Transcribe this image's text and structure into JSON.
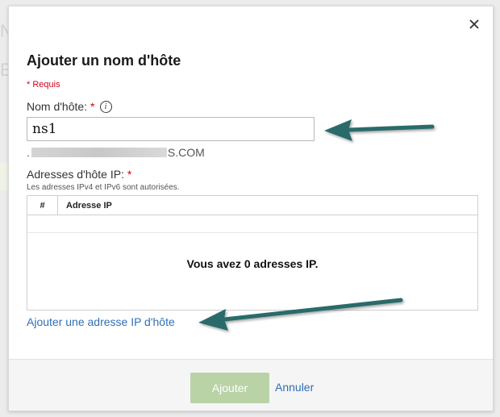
{
  "dialog": {
    "title": "Ajouter un nom d'hôte",
    "required_note": "* Requis",
    "close_icon": "close-icon"
  },
  "hostname": {
    "label": "Nom d'hôte:",
    "required_marker": "*",
    "info_icon": "info-icon",
    "value": "ns1",
    "domain_prefix": ".",
    "domain_suffix": "S.COM"
  },
  "ip_addresses": {
    "label": "Adresses d'hôte IP:",
    "required_marker": "*",
    "hint": "Les adresses IPv4 et IPv6 sont autorisées.",
    "columns": [
      "#",
      "Adresse IP"
    ],
    "empty_message": "Vous avez 0 adresses IP.",
    "add_link": "Ajouter une adresse IP d'hôte"
  },
  "footer": {
    "submit_label": "Ajouter",
    "cancel_label": "Annuler"
  },
  "colors": {
    "required": "#d0021b",
    "link": "#2f6fb3",
    "submit_disabled": "#b9d3a6",
    "annotation_arrow": "#2a6a6a"
  }
}
